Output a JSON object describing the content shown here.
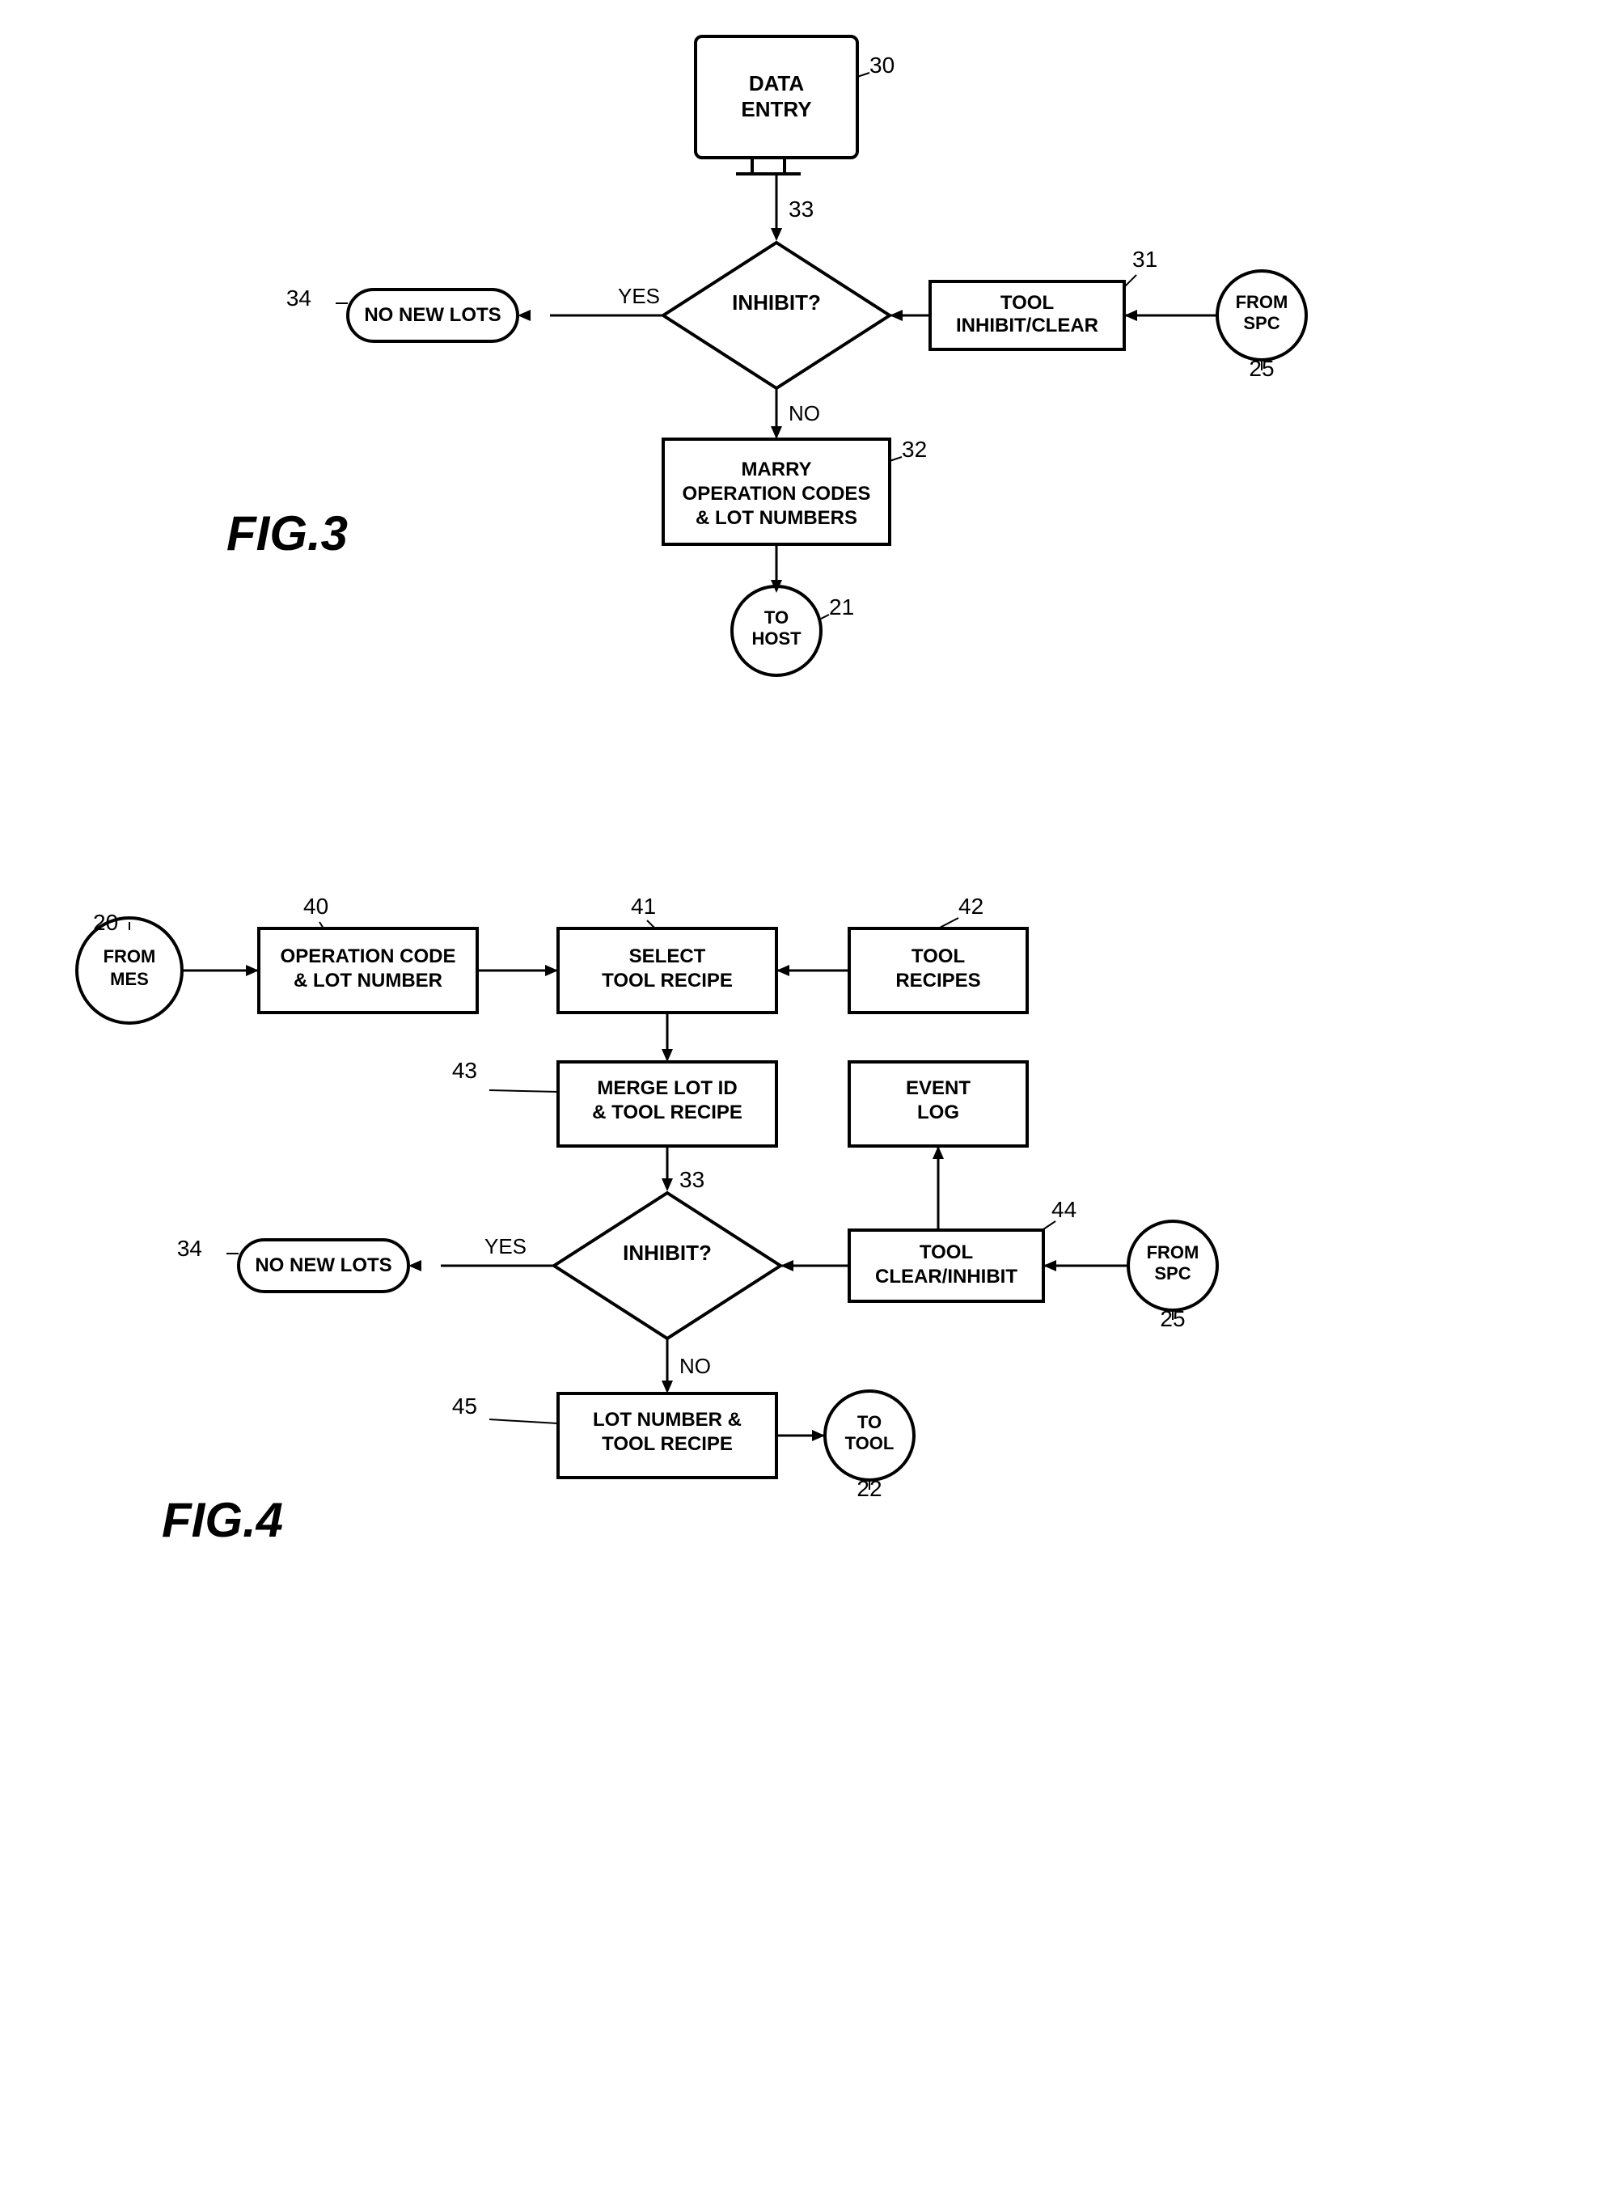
{
  "fig3": {
    "label": "FIG.3",
    "nodes": {
      "dataEntry": {
        "label": [
          "DATA",
          "ENTRY"
        ],
        "ref": "30"
      },
      "inhibit": {
        "label": "INHIBIT?",
        "ref": "33"
      },
      "toolInhibitClear": {
        "label": [
          "TOOL",
          "INHIBIT/CLEAR"
        ],
        "ref": "31"
      },
      "fromSpc": {
        "label": [
          "FROM",
          "SPC"
        ],
        "ref": "25"
      },
      "noNewLots": {
        "label": "NO NEW LOTS",
        "ref": "34"
      },
      "marryOp": {
        "label": [
          "MARRY",
          "OPERATION CODES",
          "& LOT NUMBERS"
        ],
        "ref": "32"
      },
      "toHost": {
        "label": [
          "TO",
          "HOST"
        ],
        "ref": "21"
      }
    },
    "arrows": {
      "yes": "YES",
      "no": "NO"
    }
  },
  "fig4": {
    "label": "FIG.4",
    "nodes": {
      "fromMes": {
        "label": [
          "FROM",
          "MES"
        ],
        "ref": "20"
      },
      "opCode": {
        "label": [
          "OPERATION CODE",
          "& LOT NUMBER"
        ],
        "ref": "40"
      },
      "selectTool": {
        "label": [
          "SELECT",
          "TOOL RECIPE"
        ],
        "ref": "41"
      },
      "toolRecipes": {
        "label": [
          "TOOL",
          "RECIPES"
        ],
        "ref": "42"
      },
      "mergeLot": {
        "label": [
          "MERGE LOT ID",
          "& TOOL RECIPE"
        ],
        "ref": "43"
      },
      "eventLog": {
        "label": [
          "EVENT",
          "LOG"
        ],
        "ref": ""
      },
      "inhibit": {
        "label": "INHIBIT?",
        "ref": "33"
      },
      "toolClearInhibit": {
        "label": [
          "TOOL",
          "CLEAR/INHIBIT"
        ],
        "ref": "44"
      },
      "fromSpc": {
        "label": [
          "FROM",
          "SPC"
        ],
        "ref": "25"
      },
      "noNewLots": {
        "label": "NO NEW LOTS",
        "ref": "34"
      },
      "lotNumberTool": {
        "label": [
          "LOT NUMBER &",
          "TOOL RECIPE"
        ],
        "ref": "45"
      },
      "toTool": {
        "label": [
          "TO",
          "TOOL"
        ],
        "ref": "22"
      }
    },
    "arrows": {
      "yes": "YES",
      "no": "NO"
    }
  }
}
